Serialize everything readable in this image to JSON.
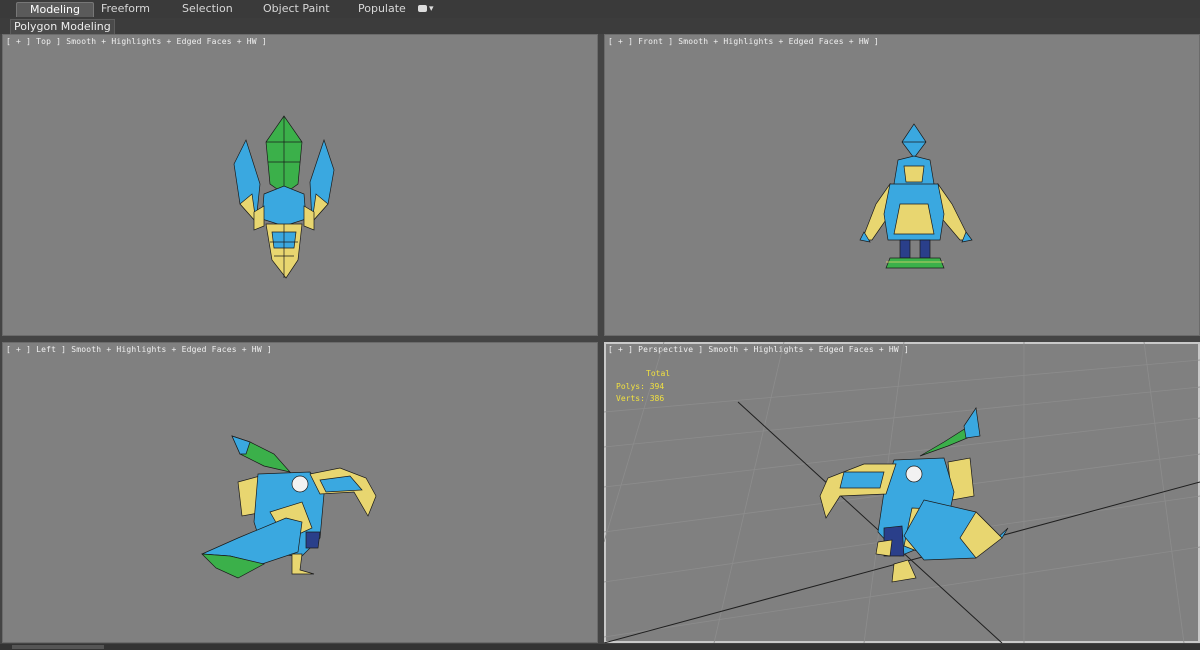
{
  "ribbon": {
    "tabs": [
      {
        "label": "Modeling",
        "active": true
      },
      {
        "label": "Freeform",
        "active": false
      },
      {
        "label": "Selection",
        "active": false
      },
      {
        "label": "Object Paint",
        "active": false
      },
      {
        "label": "Populate",
        "active": false
      }
    ],
    "extra_menu_icon": "dropdown-arrow-icon",
    "subpanel_label": "Polygon Modeling"
  },
  "viewports": {
    "top": {
      "label": "[ + ] Top ] Smooth + Highlights + Edged Faces + HW ]"
    },
    "front": {
      "label": "[ + ] Front ] Smooth + Highlights + Edged Faces + HW ]"
    },
    "left": {
      "label": "[ + ] Left ] Smooth + Highlights + Edged Faces + HW ]"
    },
    "perspective": {
      "label": "[ + ] Perspective ] Smooth + Highlights + Edged Faces + HW ]",
      "stats": {
        "header": "Total",
        "polys_label": "Polys:",
        "polys_value": "394",
        "verts_label": "Verts:",
        "verts_value": "386"
      }
    }
  },
  "colors": {
    "viewport_bg": "#808080",
    "model_blue": "#3aa8e0",
    "model_yellow": "#e8d670",
    "model_green": "#3bb04a",
    "model_navy": "#2a3f8a",
    "stats_text": "#f0e040"
  }
}
